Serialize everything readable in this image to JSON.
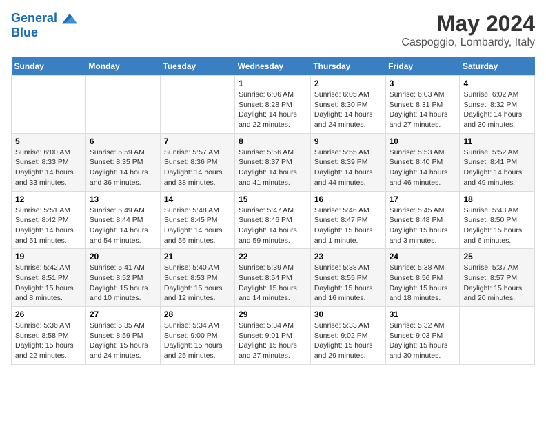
{
  "header": {
    "logo_line1": "General",
    "logo_line2": "Blue",
    "month": "May 2024",
    "location": "Caspoggio, Lombardy, Italy"
  },
  "weekdays": [
    "Sunday",
    "Monday",
    "Tuesday",
    "Wednesday",
    "Thursday",
    "Friday",
    "Saturday"
  ],
  "weeks": [
    [
      {
        "day": "",
        "sunrise": "",
        "sunset": "",
        "daylight": ""
      },
      {
        "day": "",
        "sunrise": "",
        "sunset": "",
        "daylight": ""
      },
      {
        "day": "",
        "sunrise": "",
        "sunset": "",
        "daylight": ""
      },
      {
        "day": "1",
        "sunrise": "Sunrise: 6:06 AM",
        "sunset": "Sunset: 8:28 PM",
        "daylight": "Daylight: 14 hours and 22 minutes."
      },
      {
        "day": "2",
        "sunrise": "Sunrise: 6:05 AM",
        "sunset": "Sunset: 8:30 PM",
        "daylight": "Daylight: 14 hours and 24 minutes."
      },
      {
        "day": "3",
        "sunrise": "Sunrise: 6:03 AM",
        "sunset": "Sunset: 8:31 PM",
        "daylight": "Daylight: 14 hours and 27 minutes."
      },
      {
        "day": "4",
        "sunrise": "Sunrise: 6:02 AM",
        "sunset": "Sunset: 8:32 PM",
        "daylight": "Daylight: 14 hours and 30 minutes."
      }
    ],
    [
      {
        "day": "5",
        "sunrise": "Sunrise: 6:00 AM",
        "sunset": "Sunset: 8:33 PM",
        "daylight": "Daylight: 14 hours and 33 minutes."
      },
      {
        "day": "6",
        "sunrise": "Sunrise: 5:59 AM",
        "sunset": "Sunset: 8:35 PM",
        "daylight": "Daylight: 14 hours and 36 minutes."
      },
      {
        "day": "7",
        "sunrise": "Sunrise: 5:57 AM",
        "sunset": "Sunset: 8:36 PM",
        "daylight": "Daylight: 14 hours and 38 minutes."
      },
      {
        "day": "8",
        "sunrise": "Sunrise: 5:56 AM",
        "sunset": "Sunset: 8:37 PM",
        "daylight": "Daylight: 14 hours and 41 minutes."
      },
      {
        "day": "9",
        "sunrise": "Sunrise: 5:55 AM",
        "sunset": "Sunset: 8:39 PM",
        "daylight": "Daylight: 14 hours and 44 minutes."
      },
      {
        "day": "10",
        "sunrise": "Sunrise: 5:53 AM",
        "sunset": "Sunset: 8:40 PM",
        "daylight": "Daylight: 14 hours and 46 minutes."
      },
      {
        "day": "11",
        "sunrise": "Sunrise: 5:52 AM",
        "sunset": "Sunset: 8:41 PM",
        "daylight": "Daylight: 14 hours and 49 minutes."
      }
    ],
    [
      {
        "day": "12",
        "sunrise": "Sunrise: 5:51 AM",
        "sunset": "Sunset: 8:42 PM",
        "daylight": "Daylight: 14 hours and 51 minutes."
      },
      {
        "day": "13",
        "sunrise": "Sunrise: 5:49 AM",
        "sunset": "Sunset: 8:44 PM",
        "daylight": "Daylight: 14 hours and 54 minutes."
      },
      {
        "day": "14",
        "sunrise": "Sunrise: 5:48 AM",
        "sunset": "Sunset: 8:45 PM",
        "daylight": "Daylight: 14 hours and 56 minutes."
      },
      {
        "day": "15",
        "sunrise": "Sunrise: 5:47 AM",
        "sunset": "Sunset: 8:46 PM",
        "daylight": "Daylight: 14 hours and 59 minutes."
      },
      {
        "day": "16",
        "sunrise": "Sunrise: 5:46 AM",
        "sunset": "Sunset: 8:47 PM",
        "daylight": "Daylight: 15 hours and 1 minute."
      },
      {
        "day": "17",
        "sunrise": "Sunrise: 5:45 AM",
        "sunset": "Sunset: 8:48 PM",
        "daylight": "Daylight: 15 hours and 3 minutes."
      },
      {
        "day": "18",
        "sunrise": "Sunrise: 5:43 AM",
        "sunset": "Sunset: 8:50 PM",
        "daylight": "Daylight: 15 hours and 6 minutes."
      }
    ],
    [
      {
        "day": "19",
        "sunrise": "Sunrise: 5:42 AM",
        "sunset": "Sunset: 8:51 PM",
        "daylight": "Daylight: 15 hours and 8 minutes."
      },
      {
        "day": "20",
        "sunrise": "Sunrise: 5:41 AM",
        "sunset": "Sunset: 8:52 PM",
        "daylight": "Daylight: 15 hours and 10 minutes."
      },
      {
        "day": "21",
        "sunrise": "Sunrise: 5:40 AM",
        "sunset": "Sunset: 8:53 PM",
        "daylight": "Daylight: 15 hours and 12 minutes."
      },
      {
        "day": "22",
        "sunrise": "Sunrise: 5:39 AM",
        "sunset": "Sunset: 8:54 PM",
        "daylight": "Daylight: 15 hours and 14 minutes."
      },
      {
        "day": "23",
        "sunrise": "Sunrise: 5:38 AM",
        "sunset": "Sunset: 8:55 PM",
        "daylight": "Daylight: 15 hours and 16 minutes."
      },
      {
        "day": "24",
        "sunrise": "Sunrise: 5:38 AM",
        "sunset": "Sunset: 8:56 PM",
        "daylight": "Daylight: 15 hours and 18 minutes."
      },
      {
        "day": "25",
        "sunrise": "Sunrise: 5:37 AM",
        "sunset": "Sunset: 8:57 PM",
        "daylight": "Daylight: 15 hours and 20 minutes."
      }
    ],
    [
      {
        "day": "26",
        "sunrise": "Sunrise: 5:36 AM",
        "sunset": "Sunset: 8:58 PM",
        "daylight": "Daylight: 15 hours and 22 minutes."
      },
      {
        "day": "27",
        "sunrise": "Sunrise: 5:35 AM",
        "sunset": "Sunset: 8:59 PM",
        "daylight": "Daylight: 15 hours and 24 minutes."
      },
      {
        "day": "28",
        "sunrise": "Sunrise: 5:34 AM",
        "sunset": "Sunset: 9:00 PM",
        "daylight": "Daylight: 15 hours and 25 minutes."
      },
      {
        "day": "29",
        "sunrise": "Sunrise: 5:34 AM",
        "sunset": "Sunset: 9:01 PM",
        "daylight": "Daylight: 15 hours and 27 minutes."
      },
      {
        "day": "30",
        "sunrise": "Sunrise: 5:33 AM",
        "sunset": "Sunset: 9:02 PM",
        "daylight": "Daylight: 15 hours and 29 minutes."
      },
      {
        "day": "31",
        "sunrise": "Sunrise: 5:32 AM",
        "sunset": "Sunset: 9:03 PM",
        "daylight": "Daylight: 15 hours and 30 minutes."
      },
      {
        "day": "",
        "sunrise": "",
        "sunset": "",
        "daylight": ""
      }
    ]
  ]
}
